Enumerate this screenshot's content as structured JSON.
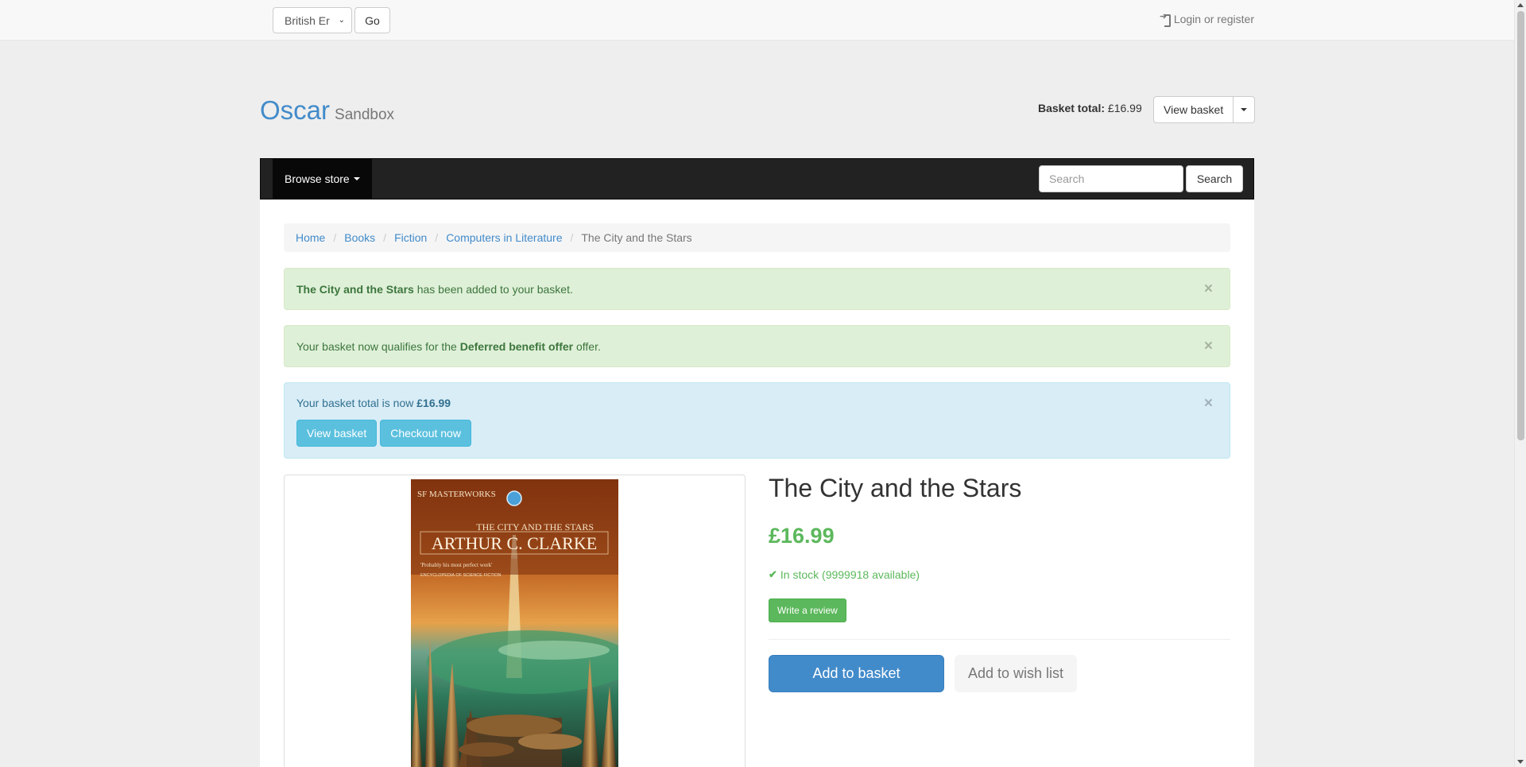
{
  "topbar": {
    "language_value": "British English",
    "language_display": "British Er",
    "go_label": "Go",
    "login_label": "Login or register"
  },
  "header": {
    "brand_name": "Oscar",
    "brand_sub": "Sandbox",
    "basket_total_label": "Basket total:",
    "basket_total_value": "£16.99",
    "view_basket_label": "View basket"
  },
  "nav": {
    "browse_label": "Browse store",
    "search_placeholder": "Search",
    "search_button": "Search"
  },
  "breadcrumb": {
    "items": [
      "Home",
      "Books",
      "Fiction",
      "Computers in Literature"
    ],
    "active": "The City and the Stars"
  },
  "alerts": {
    "added_strong": "The City and the Stars",
    "added_rest": " has been added to your basket.",
    "offer_pre": "Your basket now qualifies for the ",
    "offer_strong": "Deferred benefit offer",
    "offer_post": " offer.",
    "total_pre": "Your basket total is now ",
    "total_strong": "£16.99",
    "view_basket": "View basket",
    "checkout": "Checkout now",
    "close_glyph": "×"
  },
  "product": {
    "title": "The City and the Stars",
    "price": "£16.99",
    "stock": "In stock (9999918 available)",
    "review_button": "Write a review",
    "add_basket": "Add to basket",
    "wishlist": "Add to wish list",
    "cover": {
      "series": "SF MASTERWORKS",
      "book_title": "THE CITY AND THE STARS",
      "author": "ARTHUR C. CLARKE",
      "quote": "'Probably his most perfect work'",
      "quote_source": "ENCYCLOPEDIA OF SCIENCE FICTION"
    }
  },
  "colors": {
    "brand": "#428bca",
    "success": "#5cb85c",
    "navbar": "#222222"
  }
}
